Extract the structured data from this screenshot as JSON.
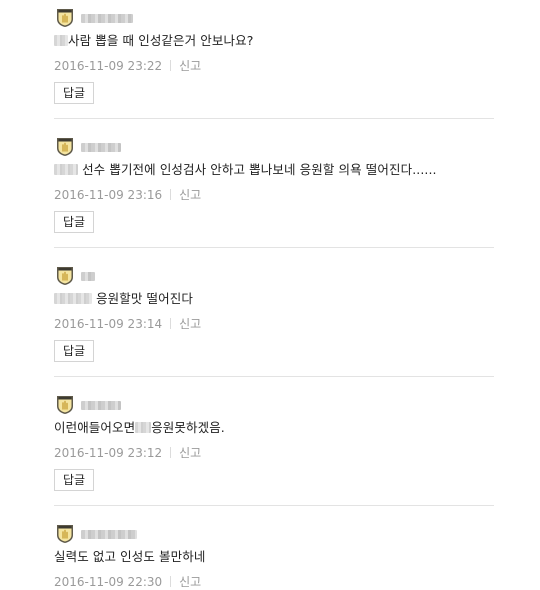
{
  "comments": [
    {
      "text_before": "",
      "blur_before": true,
      "text_after": "사람 뽑을 때 인성같은거 안보나요?",
      "date": "2016-11-09 23:22",
      "report": "신고",
      "reply": "답글"
    },
    {
      "text_before": "",
      "blur_before": true,
      "text_after": " 선수 뽑기전에 인성검사 안하고 뽑나보네 응원할 의욕 떨어진다......",
      "date": "2016-11-09 23:16",
      "report": "신고",
      "reply": "답글"
    },
    {
      "text_before": "",
      "blur_before": true,
      "text_after": " 응원할맛 떨어진다",
      "date": "2016-11-09 23:14",
      "report": "신고",
      "reply": "답글"
    },
    {
      "text_before": "이런애들어오면",
      "blur_before": false,
      "text_mid_blur": true,
      "text_after": "응원못하겠음.",
      "date": "2016-11-09 23:12",
      "report": "신고",
      "reply": "답글"
    },
    {
      "text_before": "",
      "blur_before": false,
      "text_after": "실력도 없고 인성도 볼만하네",
      "date": "2016-11-09 22:30",
      "report": "신고"
    }
  ],
  "icons": {
    "badge": "rookie-badge-icon"
  },
  "colors": {
    "meta": "#9a9a9a",
    "divider": "#e3e3e3"
  }
}
